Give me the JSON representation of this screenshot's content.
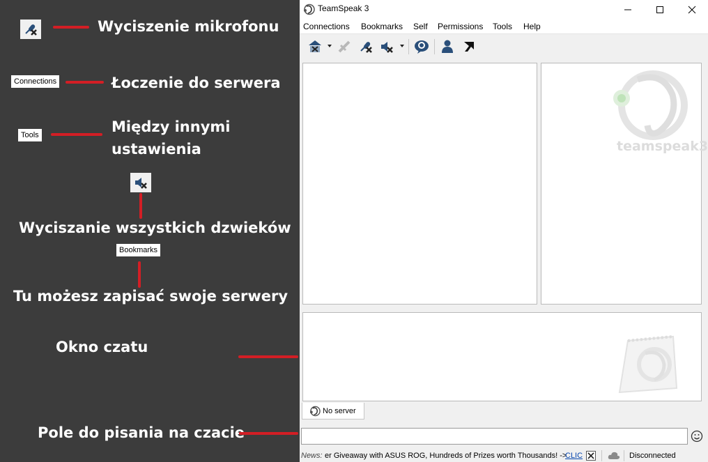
{
  "annotations": {
    "mute_mic": "Wyciszenie mikrofonu",
    "connections_box": "Connections",
    "connections_desc": "Łoczenie do serwera",
    "tools_box": "Tools",
    "tools_desc_line1": "Między innymi",
    "tools_desc_line2": "ustawienia",
    "mute_all": "Wyciszanie wszystkich dzwieków",
    "bookmarks_box": "Bookmarks",
    "bookmarks_desc": "Tu możesz zapisać swoje serwery",
    "chat_window": "Okno czatu",
    "chat_input": "Pole do pisania na czacie"
  },
  "window": {
    "title": "TeamSpeak 3",
    "menu": [
      "Connections",
      "Bookmarks",
      "Self",
      "Permissions",
      "Tools",
      "Help"
    ],
    "logo_text": "teamspeak3",
    "chat_tab": "No server",
    "news_label": "News:",
    "news_text": "er Giveaway with ASUS ROG, Hundreds of Prizes worth Thousands! ->",
    "news_link": "CLIC",
    "status": "Disconnected"
  },
  "colors": {
    "annotation_bg": "#3c3c3c",
    "accent_red": "#d31e25",
    "window_bg": "#f0f0f0"
  }
}
